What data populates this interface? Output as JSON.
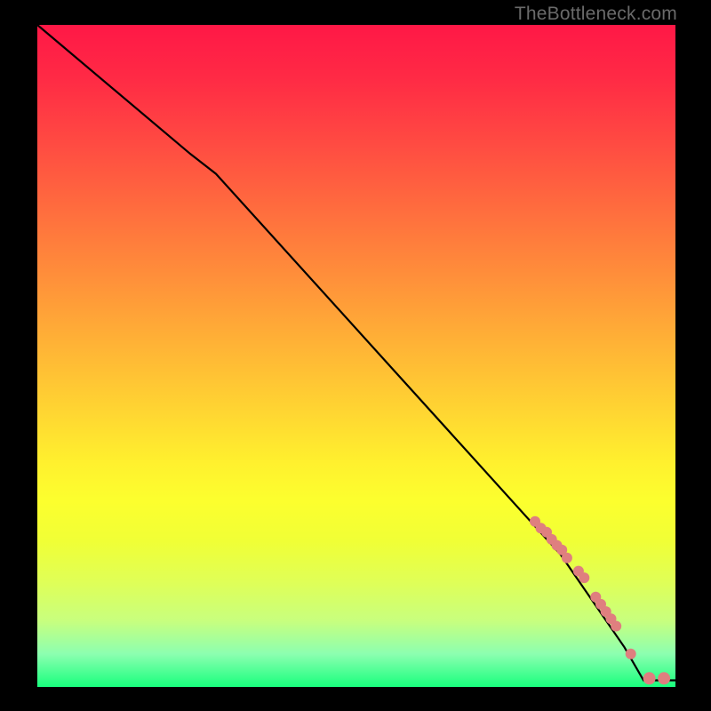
{
  "attribution": "TheBottleneck.com",
  "colors": {
    "frame": "#000000",
    "marker": "#df7f7f",
    "curve": "#000000",
    "gradient_top": "#ff1846",
    "gradient_bottom": "#18ff7d"
  },
  "chart_data": {
    "type": "line",
    "title": "",
    "xlabel": "",
    "ylabel": "",
    "xlim": [
      0,
      100
    ],
    "ylim": [
      0,
      100
    ],
    "grid": false,
    "legend": false,
    "curve_xy": [
      {
        "x": 0,
        "y": 100
      },
      {
        "x": 24,
        "y": 80.5
      },
      {
        "x": 28,
        "y": 77.5
      },
      {
        "x": 82,
        "y": 20
      },
      {
        "x": 92,
        "y": 6
      },
      {
        "x": 95,
        "y": 1
      },
      {
        "x": 100,
        "y": 1
      }
    ],
    "markers_xy": [
      {
        "x": 78.0,
        "y": 25.0,
        "r": 6
      },
      {
        "x": 78.9,
        "y": 24.0,
        "r": 6
      },
      {
        "x": 79.8,
        "y": 23.4,
        "r": 6
      },
      {
        "x": 80.6,
        "y": 22.3,
        "r": 6
      },
      {
        "x": 81.4,
        "y": 21.4,
        "r": 6
      },
      {
        "x": 82.2,
        "y": 20.7,
        "r": 6
      },
      {
        "x": 83.0,
        "y": 19.5,
        "r": 6
      },
      {
        "x": 84.8,
        "y": 17.5,
        "r": 6
      },
      {
        "x": 85.7,
        "y": 16.5,
        "r": 6
      },
      {
        "x": 87.5,
        "y": 13.6,
        "r": 6
      },
      {
        "x": 88.3,
        "y": 12.5,
        "r": 6
      },
      {
        "x": 89.1,
        "y": 11.4,
        "r": 6
      },
      {
        "x": 89.9,
        "y": 10.3,
        "r": 6
      },
      {
        "x": 90.7,
        "y": 9.2,
        "r": 6
      },
      {
        "x": 93.0,
        "y": 5.0,
        "r": 6
      },
      {
        "x": 95.9,
        "y": 1.3,
        "r": 7
      },
      {
        "x": 98.2,
        "y": 1.3,
        "r": 7
      }
    ]
  }
}
